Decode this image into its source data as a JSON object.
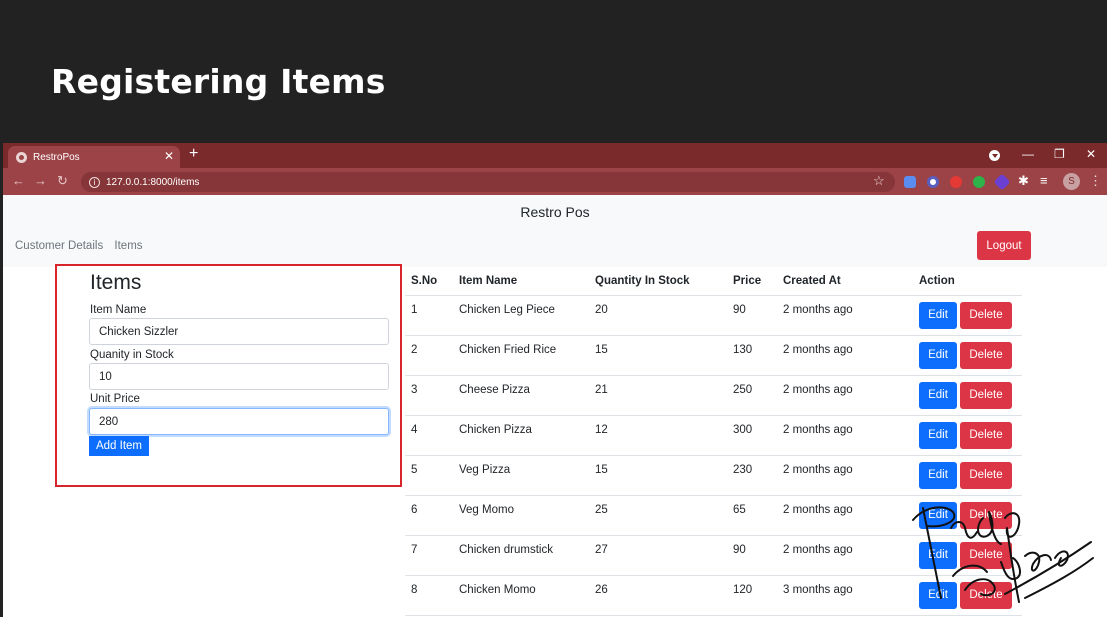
{
  "slide": {
    "title": "Registering Items"
  },
  "browser": {
    "tab_title": "RestroPos",
    "tab_close": "✕",
    "new_tab": "+",
    "url": "127.0.0.1:8000/items",
    "profile_initial": "S",
    "extension_colors": [
      "#5b8cf0",
      "#ffffff",
      "#e53935",
      "#2db34a",
      "#6a3fd1",
      "#ffffff"
    ]
  },
  "app": {
    "brand": "Restro Pos",
    "nav": [
      "Customer Details",
      "Items"
    ],
    "logout_label": "Logout"
  },
  "form": {
    "title": "Items",
    "fields": [
      {
        "label": "Item Name",
        "value": "Chicken Sizzler"
      },
      {
        "label": "Quanity in Stock",
        "value": "10"
      },
      {
        "label": "Unit Price",
        "value": "280"
      }
    ],
    "submit_label": "Add Item"
  },
  "table": {
    "columns": [
      "S.No",
      "Item Name",
      "Quantity In Stock",
      "Price",
      "Created At",
      "Action"
    ],
    "edit_label": "Edit",
    "delete_label": "Delete",
    "rows": [
      {
        "sno": "1",
        "name": "Chicken Leg Piece",
        "qty": "20",
        "price": "90",
        "created": "2 months ago"
      },
      {
        "sno": "2",
        "name": "Chicken Fried Rice",
        "qty": "15",
        "price": "130",
        "created": "2 months ago"
      },
      {
        "sno": "3",
        "name": "Cheese Pizza",
        "qty": "21",
        "price": "250",
        "created": "2 months ago"
      },
      {
        "sno": "4",
        "name": "Chicken Pizza",
        "qty": "12",
        "price": "300",
        "created": "2 months ago"
      },
      {
        "sno": "5",
        "name": "Veg Pizza",
        "qty": "15",
        "price": "230",
        "created": "2 months ago"
      },
      {
        "sno": "6",
        "name": "Veg Momo",
        "qty": "25",
        "price": "65",
        "created": "2 months ago"
      },
      {
        "sno": "7",
        "name": "Chicken drumstick",
        "qty": "27",
        "price": "90",
        "created": "2 months ago"
      },
      {
        "sno": "8",
        "name": "Chicken Momo",
        "qty": "26",
        "price": "120",
        "created": "3 months ago"
      }
    ]
  },
  "signature_text": "Pradip Pokhrel"
}
